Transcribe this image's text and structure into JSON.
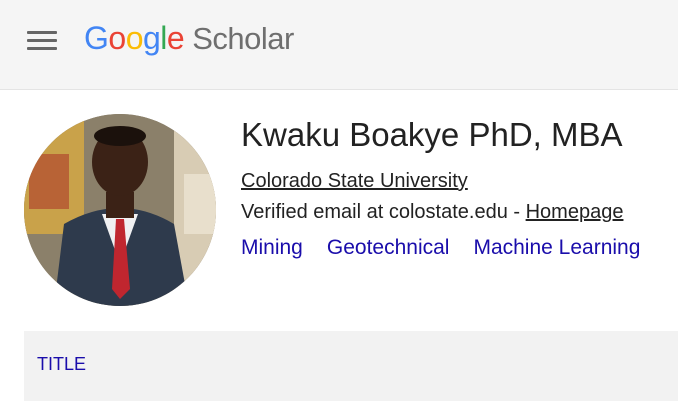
{
  "header": {
    "logo_letters": [
      "G",
      "o",
      "o",
      "g",
      "l",
      "e"
    ],
    "logo_colors": [
      "#4285F4",
      "#EA4335",
      "#FBBC05",
      "#4285F4",
      "#34A853",
      "#EA4335"
    ],
    "logo_suffix": "Scholar",
    "menu_icon": "hamburger-icon"
  },
  "profile": {
    "name": "Kwaku Boakye PhD, MBA",
    "affiliation": "Colorado State University",
    "email_text": "Verified email at colostate.edu - ",
    "homepage_label": "Homepage",
    "interests": [
      "Mining",
      "Geotechnical",
      "Machine Learning"
    ]
  },
  "table": {
    "title_header": "TITLE"
  },
  "colors": {
    "link": "#1a0dab",
    "topbar": "#f5f5f5",
    "table_header": "#f2f2f2"
  }
}
